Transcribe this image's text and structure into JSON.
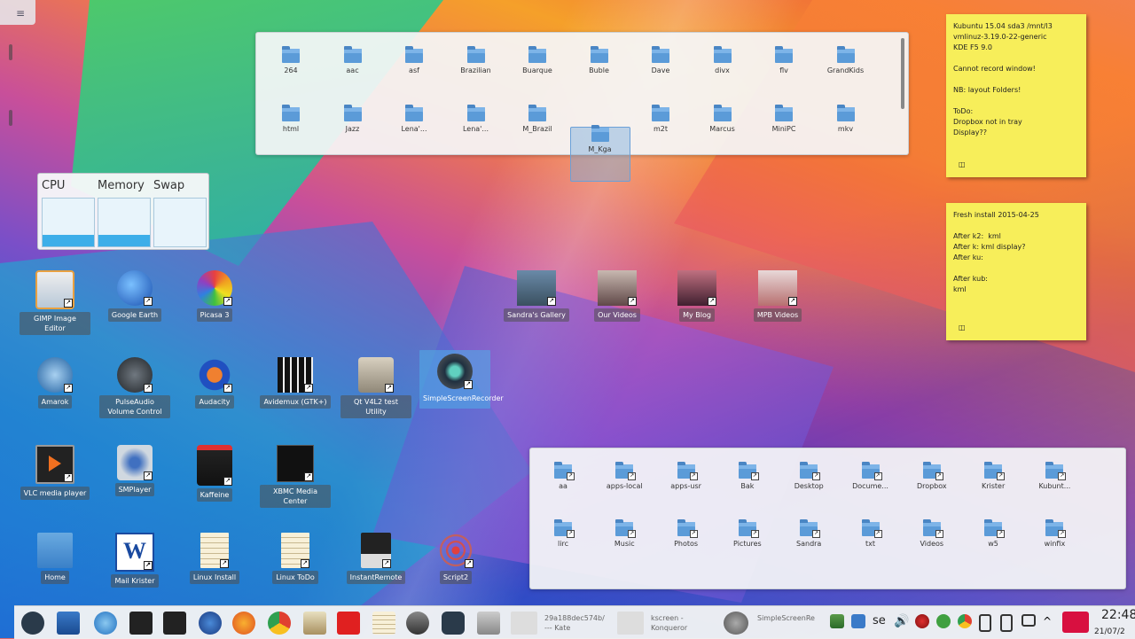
{
  "top_folderview": {
    "items": [
      {
        "label": "264"
      },
      {
        "label": "aac"
      },
      {
        "label": "asf"
      },
      {
        "label": "Brazilian"
      },
      {
        "label": "Buarque"
      },
      {
        "label": "Buble"
      },
      {
        "label": "Dave"
      },
      {
        "label": "divx"
      },
      {
        "label": "flv"
      },
      {
        "label": "GrandKids"
      },
      {
        "label": "html"
      },
      {
        "label": "Jazz"
      },
      {
        "label": "Lena'..."
      },
      {
        "label": "Lena'..."
      },
      {
        "label": "M_Brazil"
      },
      {
        "label": "M_Kga"
      },
      {
        "label": "m2t"
      },
      {
        "label": "Marcus"
      },
      {
        "label": "MiniPC"
      },
      {
        "label": "mkv"
      }
    ],
    "selected_index": 15
  },
  "bottom_folderview": {
    "items": [
      {
        "label": "aa"
      },
      {
        "label": "apps-local"
      },
      {
        "label": "apps-usr"
      },
      {
        "label": "Bak"
      },
      {
        "label": "Desktop"
      },
      {
        "label": "Docume..."
      },
      {
        "label": "Dropbox"
      },
      {
        "label": "Krister"
      },
      {
        "label": "Kubunt..."
      },
      {
        "label": "lirc"
      },
      {
        "label": "Music"
      },
      {
        "label": "Photos"
      },
      {
        "label": "Pictures"
      },
      {
        "label": "Sandra"
      },
      {
        "label": "txt"
      },
      {
        "label": "Videos"
      },
      {
        "label": "w5"
      },
      {
        "label": "winfix"
      }
    ]
  },
  "system_monitor": {
    "labels": [
      "CPU",
      "Memory",
      "Swap"
    ],
    "levels": [
      0.25,
      0.25,
      0.0
    ],
    "fill_color": "#3daee9"
  },
  "desktop_icons": {
    "gimp": "GIMP Image Editor",
    "google_earth": "Google Earth",
    "picasa": "Picasa 3",
    "sandras_gallery": "Sandra's Gallery",
    "our_videos": "Our Videos",
    "my_blog": "My Blog",
    "mpb_videos": "MPB Videos",
    "amarok": "Amarok",
    "pulseaudio": "PulseAudio Volume Control",
    "audacity": "Audacity",
    "avidemux": "Avidemux (GTK+)",
    "qt_v4l2": "Qt V4L2 test Utility",
    "simplescreenrecorder": "SimpleScreenRecorder",
    "vlc": "VLC media player",
    "smplayer": "SMPlayer",
    "kaffeine": "Kaffeine",
    "xbmc": "XBMC Media Center",
    "home": "Home",
    "mail_krister": "Mail Krister",
    "linux_install": "Linux Install",
    "linux_todo": "Linux ToDo",
    "instantremote": "InstantRemote",
    "script2": "Script2"
  },
  "note1": {
    "text": "Kubuntu 15.04 sda3 /mnt/l3\nvmlinuz-3.19.0-22-generic\nKDE F5 9.0\n\nCannot record window!\n\nNB: layout Folders!\n\nToDo:\nDropbox not in tray\nDisplay??"
  },
  "note2": {
    "text": "Fresh install 2015-04-25\n\nAfter k2:  kml\nAfter k: kml display?\nAfter ku:\n\nAfter kub:\nkml"
  },
  "taskbar": {
    "task1": "29a188dec574b/\n--- Kate",
    "task2": "kscreen -\nKonqueror",
    "task3": "SimpleScreenRe",
    "keyboard_layout": "se",
    "clock": "22:48",
    "date": "21/07/2"
  }
}
